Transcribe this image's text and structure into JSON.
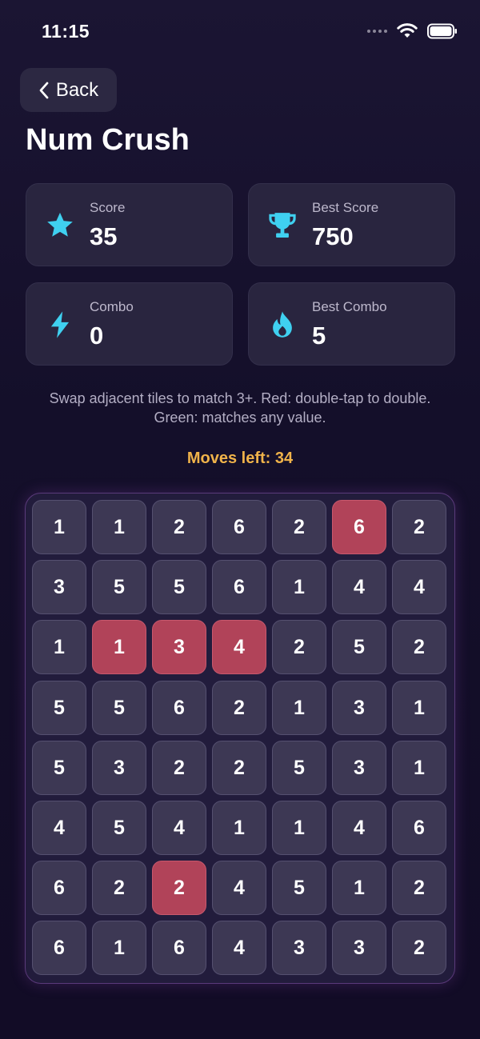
{
  "status": {
    "time": "11:15"
  },
  "nav": {
    "back_label": "Back"
  },
  "title": "Num Crush",
  "stats": [
    {
      "label": "Score",
      "value": "35",
      "icon": "star-icon"
    },
    {
      "label": "Best Score",
      "value": "750",
      "icon": "trophy-icon"
    },
    {
      "label": "Combo",
      "value": "0",
      "icon": "lightning-icon"
    },
    {
      "label": "Best Combo",
      "value": "5",
      "icon": "flame-icon"
    }
  ],
  "instructions": "Swap adjacent tiles to match 3+. Red: double-tap to double. Green: matches any value.",
  "moves_left": "Moves left: 34",
  "colors": {
    "accent": "#3fd0f0",
    "moves": "#f0b34a",
    "red_tile": "#b14359",
    "tile": "#3d3854"
  },
  "board": {
    "rows": [
      [
        {
          "v": "1",
          "t": "n"
        },
        {
          "v": "1",
          "t": "n"
        },
        {
          "v": "2",
          "t": "n"
        },
        {
          "v": "6",
          "t": "n"
        },
        {
          "v": "2",
          "t": "n"
        },
        {
          "v": "6",
          "t": "red"
        },
        {
          "v": "2",
          "t": "n"
        }
      ],
      [
        {
          "v": "3",
          "t": "n"
        },
        {
          "v": "5",
          "t": "n"
        },
        {
          "v": "5",
          "t": "n"
        },
        {
          "v": "6",
          "t": "n"
        },
        {
          "v": "1",
          "t": "n"
        },
        {
          "v": "4",
          "t": "n"
        },
        {
          "v": "4",
          "t": "n"
        }
      ],
      [
        {
          "v": "1",
          "t": "n"
        },
        {
          "v": "1",
          "t": "red"
        },
        {
          "v": "3",
          "t": "red"
        },
        {
          "v": "4",
          "t": "red"
        },
        {
          "v": "2",
          "t": "n"
        },
        {
          "v": "5",
          "t": "n"
        },
        {
          "v": "2",
          "t": "n"
        }
      ],
      [
        {
          "v": "5",
          "t": "n"
        },
        {
          "v": "5",
          "t": "n"
        },
        {
          "v": "6",
          "t": "n"
        },
        {
          "v": "2",
          "t": "n"
        },
        {
          "v": "1",
          "t": "n"
        },
        {
          "v": "3",
          "t": "n"
        },
        {
          "v": "1",
          "t": "n"
        }
      ],
      [
        {
          "v": "5",
          "t": "n"
        },
        {
          "v": "3",
          "t": "n"
        },
        {
          "v": "2",
          "t": "n"
        },
        {
          "v": "2",
          "t": "n"
        },
        {
          "v": "5",
          "t": "n"
        },
        {
          "v": "3",
          "t": "n"
        },
        {
          "v": "1",
          "t": "n"
        }
      ],
      [
        {
          "v": "4",
          "t": "n"
        },
        {
          "v": "5",
          "t": "n"
        },
        {
          "v": "4",
          "t": "n"
        },
        {
          "v": "1",
          "t": "n"
        },
        {
          "v": "1",
          "t": "n"
        },
        {
          "v": "4",
          "t": "n"
        },
        {
          "v": "6",
          "t": "n"
        }
      ],
      [
        {
          "v": "6",
          "t": "n"
        },
        {
          "v": "2",
          "t": "n"
        },
        {
          "v": "2",
          "t": "red"
        },
        {
          "v": "4",
          "t": "n"
        },
        {
          "v": "5",
          "t": "n"
        },
        {
          "v": "1",
          "t": "n"
        },
        {
          "v": "2",
          "t": "n"
        }
      ],
      [
        {
          "v": "6",
          "t": "n"
        },
        {
          "v": "1",
          "t": "n"
        },
        {
          "v": "6",
          "t": "n"
        },
        {
          "v": "4",
          "t": "n"
        },
        {
          "v": "3",
          "t": "n"
        },
        {
          "v": "3",
          "t": "n"
        },
        {
          "v": "2",
          "t": "n"
        }
      ]
    ]
  }
}
